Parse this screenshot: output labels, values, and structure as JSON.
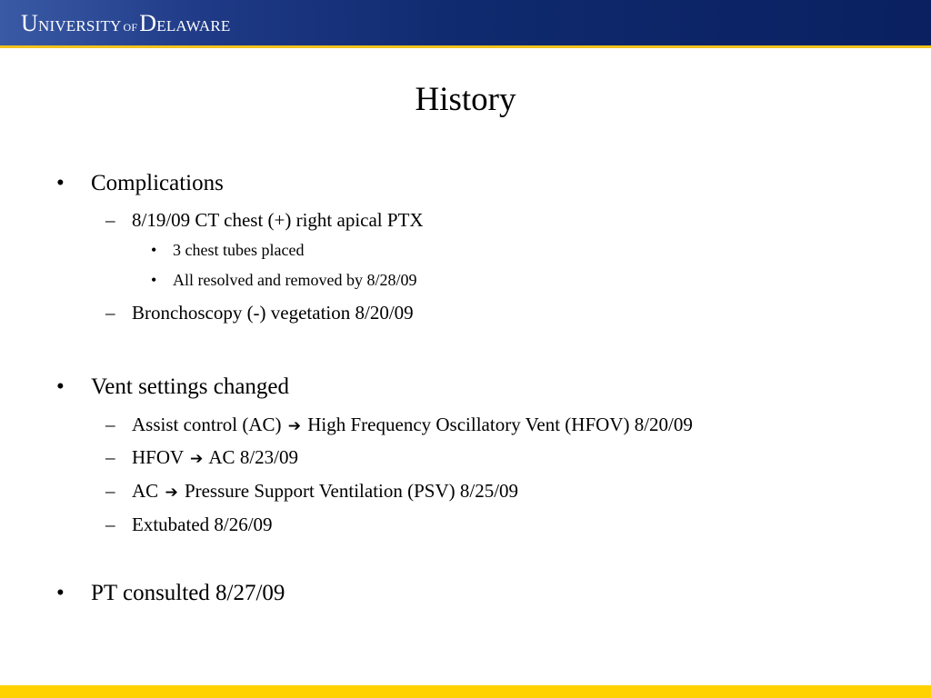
{
  "header": {
    "logo_text": "UNIVERSITY OF DELAWARE"
  },
  "title": "History",
  "sections": [
    {
      "bullet": "•",
      "label": "Complications",
      "items": [
        {
          "marker": "–",
          "text": "8/19/09 CT chest (+) right apical PTX",
          "subitems": [
            {
              "marker": "•",
              "text": "3 chest tubes placed"
            },
            {
              "marker": "•",
              "text": "All resolved and removed by 8/28/09"
            }
          ]
        },
        {
          "marker": "–",
          "text": "Bronchoscopy (-) vegetation 8/20/09"
        }
      ]
    },
    {
      "bullet": "•",
      "label": "Vent settings changed",
      "items": [
        {
          "marker": "–",
          "from": "Assist control (AC)",
          "arrow": "➔",
          "to": "High Frequency Oscillatory Vent (HFOV) 8/20/09"
        },
        {
          "marker": "–",
          "from": "HFOV",
          "arrow": "➔",
          "to": "AC 8/23/09"
        },
        {
          "marker": "–",
          "from": "AC",
          "arrow": "➔",
          "to": "Pressure Support Ventilation (PSV) 8/25/09"
        },
        {
          "marker": "–",
          "text": "Extubated 8/26/09"
        }
      ]
    },
    {
      "bullet": "•",
      "label": "PT consulted 8/27/09",
      "items": []
    }
  ],
  "colors": {
    "header_blue": "#0f2a6e",
    "header_accent": "#f2c21b",
    "footer_yellow": "#ffd200"
  }
}
